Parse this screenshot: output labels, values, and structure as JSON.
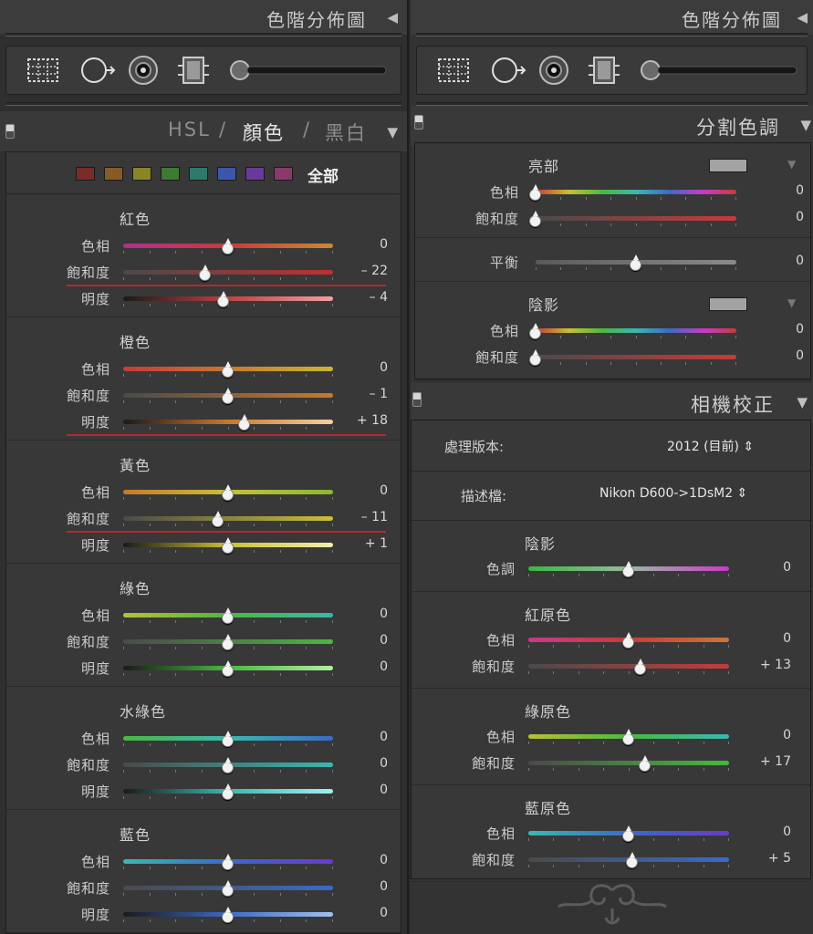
{
  "left": {
    "histogram": {
      "title": "色階分佈圖",
      "collapse_glyph": "◀"
    },
    "tools": [
      "crop-overlay-icon",
      "spot-removal-icon",
      "red-eye-icon",
      "graduated-filter-icon",
      "adjustment-brush-icon"
    ],
    "hsl_panel": {
      "tab_hsl": "HSL",
      "sep1": "/",
      "tab_color": "顏色",
      "sep2": "/",
      "tab_bw": "黑白",
      "collapse_glyph": "▼",
      "swatches": [
        "#7a2b2b",
        "#8a5a26",
        "#8a8628",
        "#3e7a32",
        "#2e7a6a",
        "#3b57a8",
        "#6a3a9a",
        "#8a3a6a"
      ],
      "all_label": "全部",
      "groups": [
        {
          "title": "紅色",
          "rows": [
            {
              "label": "色相",
              "value": "0",
              "pos": 0.5,
              "underline": false,
              "gradient": "linear-gradient(90deg,#b0308c,#c83a3a,#c88a34)"
            },
            {
              "label": "飽和度",
              "value": "– 22",
              "pos": 0.39,
              "underline": true,
              "gradient": "linear-gradient(90deg,#4a4a4a,#c03030)"
            },
            {
              "label": "明度",
              "value": "– 4",
              "pos": 0.48,
              "underline": false,
              "gradient": "linear-gradient(90deg,#1a1a1a,#c04040,#f0a0a0)"
            }
          ]
        },
        {
          "title": "橙色",
          "rows": [
            {
              "label": "色相",
              "value": "0",
              "pos": 0.5,
              "underline": false,
              "gradient": "linear-gradient(90deg,#c83a3a,#c8782e,#c8b834)"
            },
            {
              "label": "飽和度",
              "value": "– 1",
              "pos": 0.5,
              "underline": false,
              "gradient": "linear-gradient(90deg,#4a4a4a,#c8782e)"
            },
            {
              "label": "明度",
              "value": "+ 18",
              "pos": 0.58,
              "underline": true,
              "gradient": "linear-gradient(90deg,#1a1a1a,#c8782e,#f0d0a0)"
            }
          ]
        },
        {
          "title": "黃色",
          "rows": [
            {
              "label": "色相",
              "value": "0",
              "pos": 0.5,
              "underline": false,
              "gradient": "linear-gradient(90deg,#c8782e,#c8c034,#8ab834)"
            },
            {
              "label": "飽和度",
              "value": "– 11",
              "pos": 0.45,
              "underline": true,
              "gradient": "linear-gradient(90deg,#4a4a4a,#c8c034)"
            },
            {
              "label": "明度",
              "value": "+ 1",
              "pos": 0.5,
              "underline": false,
              "gradient": "linear-gradient(90deg,#1a1a1a,#c8c034,#f0f0b0)"
            }
          ]
        },
        {
          "title": "綠色",
          "rows": [
            {
              "label": "色相",
              "value": "0",
              "pos": 0.5,
              "underline": false,
              "gradient": "linear-gradient(90deg,#b8c034,#4ab840,#3ab8a8)"
            },
            {
              "label": "飽和度",
              "value": "0",
              "pos": 0.5,
              "underline": false,
              "gradient": "linear-gradient(90deg,#4a4a4a,#4ab840)"
            },
            {
              "label": "明度",
              "value": "0",
              "pos": 0.5,
              "underline": false,
              "gradient": "linear-gradient(90deg,#1a1a1a,#4ab840,#b0f0a0)"
            }
          ]
        },
        {
          "title": "水綠色",
          "rows": [
            {
              "label": "色相",
              "value": "0",
              "pos": 0.5,
              "underline": false,
              "gradient": "linear-gradient(90deg,#4ab840,#3ab8b0,#3a6ac8)"
            },
            {
              "label": "飽和度",
              "value": "0",
              "pos": 0.5,
              "underline": false,
              "gradient": "linear-gradient(90deg,#4a4a4a,#3ab8b0)"
            },
            {
              "label": "明度",
              "value": "0",
              "pos": 0.5,
              "underline": false,
              "gradient": "linear-gradient(90deg,#1a1a1a,#3ab8b0,#a0f0f0)"
            }
          ]
        },
        {
          "title": "藍色",
          "rows": [
            {
              "label": "色相",
              "value": "0",
              "pos": 0.5,
              "underline": false,
              "gradient": "linear-gradient(90deg,#3ab8b0,#3a6ac8,#6a3ac8)"
            },
            {
              "label": "飽和度",
              "value": "0",
              "pos": 0.5,
              "underline": false,
              "gradient": "linear-gradient(90deg,#4a4a4a,#3a6ac8)"
            },
            {
              "label": "明度",
              "value": "0",
              "pos": 0.5,
              "underline": false,
              "gradient": "linear-gradient(90deg,#1a1a1a,#3a6ac8,#a0c0f0)"
            }
          ]
        }
      ]
    }
  },
  "right": {
    "histogram": {
      "title": "色階分佈圖",
      "collapse_glyph": "◀"
    },
    "tools": [
      "crop-overlay-icon",
      "spot-removal-icon",
      "red-eye-icon",
      "graduated-filter-icon",
      "adjustment-brush-icon"
    ],
    "split_toning": {
      "title": "分割色調",
      "collapse_glyph": "▼",
      "highlights": {
        "title": "亮部",
        "swatch_glyph": "▼",
        "rows": [
          {
            "label": "色相",
            "value": "0",
            "pos": 0.0,
            "gradient": "linear-gradient(90deg,#c83a3a,#c8c034,#4ab840,#3ab8b0,#3a6ac8,#c83ac8,#c83a3a)"
          },
          {
            "label": "飽和度",
            "value": "0",
            "pos": 0.0,
            "gradient": "linear-gradient(90deg,#4a4a4a,#c83a3a)"
          }
        ]
      },
      "balance": {
        "label": "平衡",
        "value": "0",
        "pos": 0.5,
        "gradient": "linear-gradient(90deg,#5a5a5a,#8a8a8a)"
      },
      "shadows": {
        "title": "陰影",
        "swatch_glyph": "▼",
        "rows": [
          {
            "label": "色相",
            "value": "0",
            "pos": 0.0,
            "gradient": "linear-gradient(90deg,#c83a3a,#c8c034,#4ab840,#3ab8b0,#3a6ac8,#c83ac8,#c83a3a)"
          },
          {
            "label": "飽和度",
            "value": "0",
            "pos": 0.0,
            "gradient": "linear-gradient(90deg,#4a4a4a,#c83a3a)"
          }
        ]
      }
    },
    "camera_calibration": {
      "title": "相機校正",
      "collapse_glyph": "▼",
      "process_label": "處理版本:",
      "process_value": "2012 (目前) ⇕",
      "profile_label": "描述檔:",
      "profile_value": "Nikon D600->1DsM2 ⇕",
      "groups": [
        {
          "title": "陰影",
          "rows": [
            {
              "label": "色調",
              "value": "0",
              "pos": 0.5,
              "gradient": "linear-gradient(90deg,#3ab840,#9ab8a0,#c83ac8)"
            }
          ]
        },
        {
          "title": "紅原色",
          "rows": [
            {
              "label": "色相",
              "value": "0",
              "pos": 0.5,
              "gradient": "linear-gradient(90deg,#c83a8a,#c83a3a,#c8783a)"
            },
            {
              "label": "飽和度",
              "value": "+ 13",
              "pos": 0.56,
              "gradient": "linear-gradient(90deg,#4a4a4a,#c83a3a)"
            }
          ]
        },
        {
          "title": "綠原色",
          "rows": [
            {
              "label": "色相",
              "value": "0",
              "pos": 0.5,
              "gradient": "linear-gradient(90deg,#b8c034,#4ab840,#3ab8b0)"
            },
            {
              "label": "飽和度",
              "value": "+ 17",
              "pos": 0.58,
              "gradient": "linear-gradient(90deg,#4a4a4a,#4ab840)"
            }
          ]
        },
        {
          "title": "藍原色",
          "rows": [
            {
              "label": "色相",
              "value": "0",
              "pos": 0.5,
              "gradient": "linear-gradient(90deg,#3ab8b0,#3a6ac8,#6a3ac8)"
            },
            {
              "label": "飽和度",
              "value": "+ 5",
              "pos": 0.52,
              "gradient": "linear-gradient(90deg,#4a4a4a,#3a6ac8)"
            }
          ]
        }
      ]
    }
  }
}
